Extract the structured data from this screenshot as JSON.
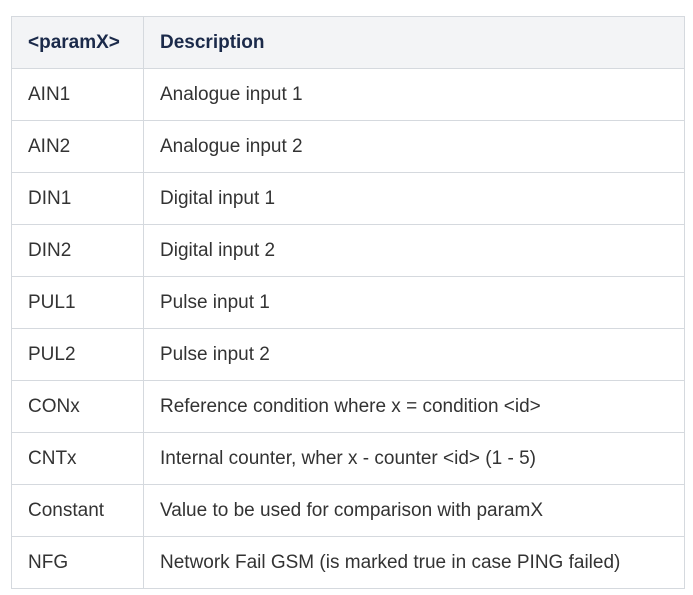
{
  "table": {
    "headers": [
      "<paramX>",
      "Description"
    ],
    "rows": [
      [
        "AIN1",
        "Analogue input 1"
      ],
      [
        "AIN2",
        "Analogue input 2"
      ],
      [
        "DIN1",
        "Digital input 1"
      ],
      [
        "DIN2",
        "Digital input 2"
      ],
      [
        "PUL1",
        "Pulse input 1"
      ],
      [
        "PUL2",
        "Pulse input 2"
      ],
      [
        "CONx",
        "Reference condition where x = condition <id>"
      ],
      [
        "CNTx",
        "Internal counter, wher x - counter <id> (1 - 5)"
      ],
      [
        "Constant",
        "Value to be used for comparison with paramX"
      ],
      [
        "NFG",
        "Network Fail GSM (is marked true in case PING failed)"
      ]
    ]
  },
  "colors": {
    "header_bg": "#f3f4f6",
    "header_text": "#1b2a4a",
    "border": "#d5d9de",
    "body_text": "#333333"
  }
}
